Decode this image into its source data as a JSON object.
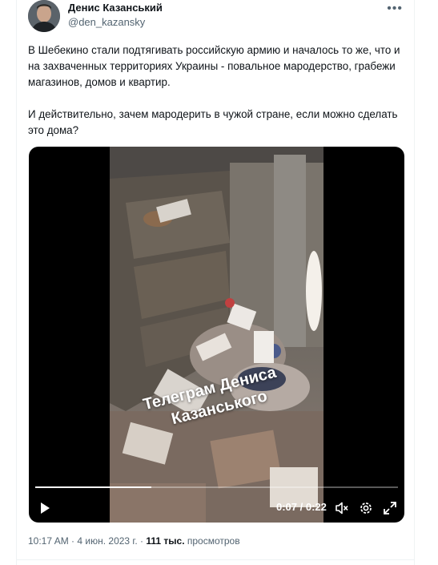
{
  "author": {
    "name": "Денис Казанський",
    "handle": "@den_kazansky"
  },
  "more_icon": "more-dots-icon",
  "tweet": {
    "paragraph1": "В Шебекино стали подтягивать российскую армию и началось то же, что и на захваченных территориях Украины - повальное мародерство, грабежи магазинов, домов и квартир.",
    "paragraph2": "И действительно, зачем мародерить в чужой стране, если можно сделать это дома?"
  },
  "video": {
    "watermark_line1": "Телеграм Дениса",
    "watermark_line2": "Казанського",
    "time": "0:07 / 0:22",
    "progress_fraction": 0.32,
    "controls": [
      "play-icon",
      "volume-icon",
      "settings-icon",
      "fullscreen-icon"
    ]
  },
  "meta": {
    "time": "10:17 AM",
    "separator1": "·",
    "date": "4 июн. 2023 г.",
    "separator2": "·",
    "views_count": "111 тыс.",
    "views_label": "просмотров"
  }
}
